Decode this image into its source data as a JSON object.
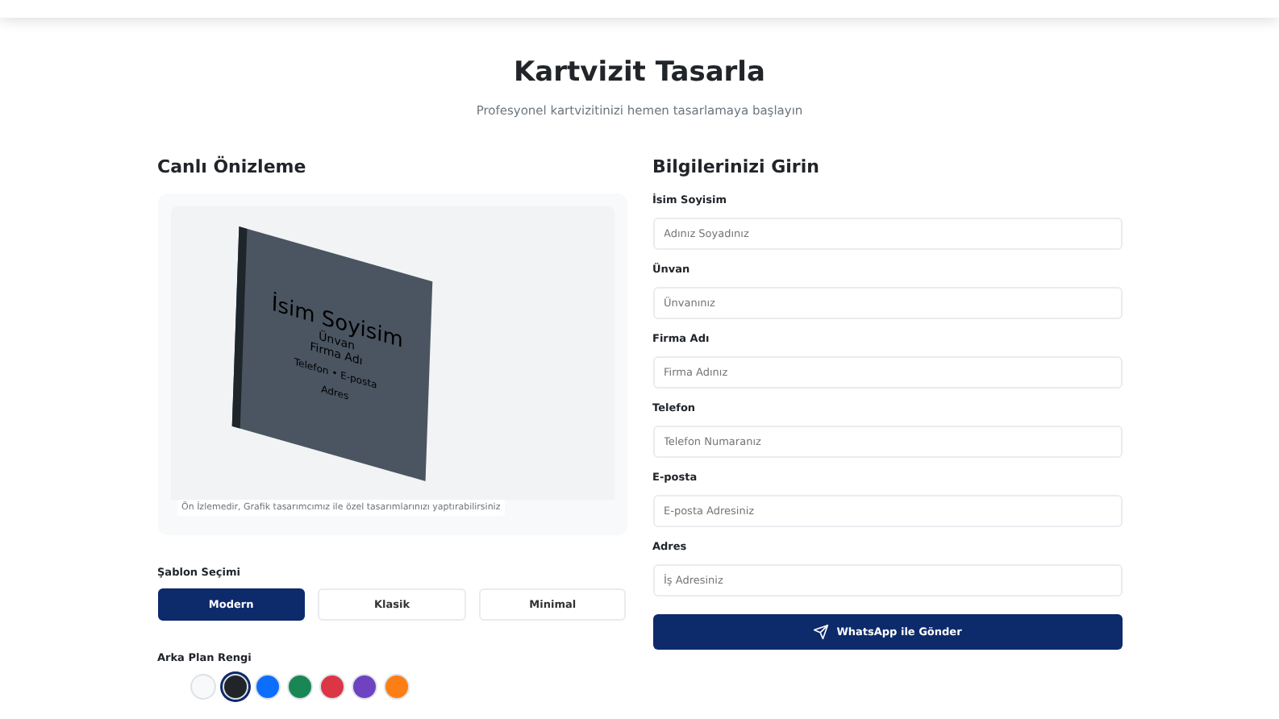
{
  "page": {
    "title": "Kartvizit Tasarla",
    "subtitle": "Profesyonel kartvizitinizi hemen tasarlamaya başlayın"
  },
  "preview": {
    "heading": "Canlı Önizleme",
    "card": {
      "name": "İsim Soyisim",
      "title": "Ünvan",
      "company": "Firma Adı",
      "contact": "Telefon • E-posta",
      "address": "Adres"
    },
    "note": "Ön İzlemedir, Grafik tasarımcımız ile özel tasarımlarınızı yaptırabilirsiniz"
  },
  "template": {
    "label": "Şablon Seçimi",
    "options": [
      {
        "label": "Modern",
        "selected": true
      },
      {
        "label": "Klasik",
        "selected": false
      },
      {
        "label": "Minimal",
        "selected": false
      }
    ]
  },
  "background": {
    "label": "Arka Plan Rengi",
    "swatches": [
      {
        "color": "#f8f9fa",
        "selected": false
      },
      {
        "color": "#212529",
        "selected": true
      },
      {
        "color": "#0d6efd",
        "selected": false
      },
      {
        "color": "#198754",
        "selected": false
      },
      {
        "color": "#dc3545",
        "selected": false
      },
      {
        "color": "#6f42c1",
        "selected": false
      },
      {
        "color": "#fd7e14",
        "selected": false
      }
    ]
  },
  "form": {
    "heading": "Bilgilerinizi Girin",
    "fields": [
      {
        "label": "İsim Soyisim",
        "placeholder": "Adınız Soyadınız"
      },
      {
        "label": "Ünvan",
        "placeholder": "Ünvanınız"
      },
      {
        "label": "Firma Adı",
        "placeholder": "Firma Adınız"
      },
      {
        "label": "Telefon",
        "placeholder": "Telefon Numaranız"
      },
      {
        "label": "E-posta",
        "placeholder": "E-posta Adresiniz"
      },
      {
        "label": "Adres",
        "placeholder": "İş Adresiniz"
      }
    ],
    "submit": "WhatsApp ile Gönder"
  }
}
